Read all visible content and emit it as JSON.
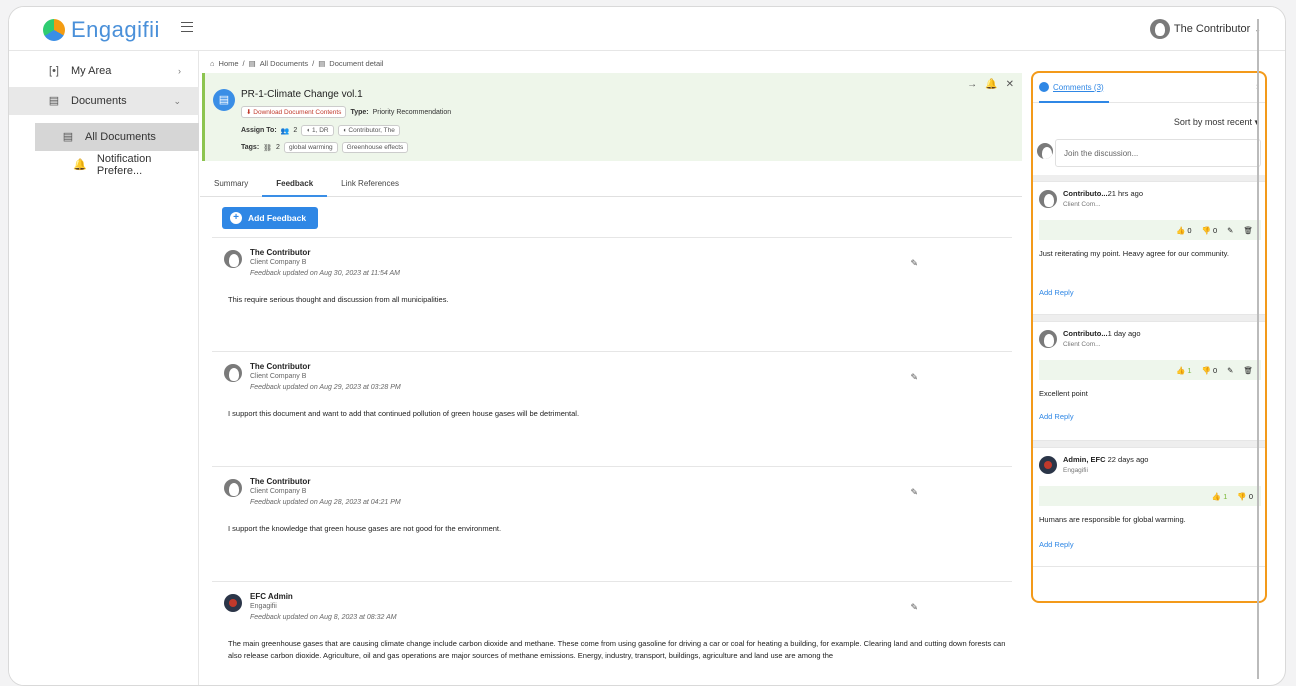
{
  "app": {
    "logo_text": "Engagifii"
  },
  "user": {
    "name": "The Contributor"
  },
  "sidebar": {
    "items": [
      {
        "label": "My Area"
      },
      {
        "label": "Documents"
      },
      {
        "label": "All Documents"
      },
      {
        "label": "Notification Prefere..."
      }
    ]
  },
  "breadcrumb": {
    "home": "Home",
    "all_documents": "All Documents",
    "current": "Document detail"
  },
  "document": {
    "title": "PR-1-Climate Change vol.1",
    "download_label": "Download Document Contents",
    "type_label": "Type:",
    "type_value": "Priority Recommendation",
    "assign_label": "Assign To:",
    "assign_count": "2",
    "assign_user1": "1, DR",
    "assign_user2": "Contributor, The",
    "tags_label": "Tags:",
    "tags_count": "2",
    "tags": [
      "global warming",
      "Greenhouse effects"
    ]
  },
  "tabs": [
    {
      "label": "Summary"
    },
    {
      "label": "Feedback"
    },
    {
      "label": "Link References"
    }
  ],
  "add_feedback_label": "Add Feedback",
  "feedback": [
    {
      "name": "The Contributor",
      "company": "Client Company B",
      "updated": "Feedback updated on Aug 30, 2023 at 11:54 AM",
      "body": "This require serious thought and discussion from all municipalities."
    },
    {
      "name": "The Contributor",
      "company": "Client Company B",
      "updated": "Feedback updated on Aug 29, 2023 at 03:28 PM",
      "body": "I support this document and want to add that continued pollution of green house gases will be detrimental."
    },
    {
      "name": "The Contributor",
      "company": "Client Company B",
      "updated": "Feedback updated on Aug 28, 2023 at 04:21 PM",
      "body": "I support the knowledge that green house gases are not good for the environment."
    },
    {
      "name": "EFC Admin",
      "company": "Engagifii",
      "updated": "Feedback updated on Aug 8, 2023 at 08:32 AM",
      "body": "The main greenhouse gases that are causing climate change include carbon dioxide and methane. These come from using gasoline for driving a car or coal for heating a building, for example. Clearing land and cutting down forests can also release carbon dioxide. Agriculture, oil and gas operations are major sources of methane emissions. Energy, industry, transport, buildings, agriculture and land use are among the"
    }
  ],
  "comments_panel": {
    "tab_label": "Comments (3)",
    "sort_label": "Sort by most recent",
    "join_placeholder": "Join the discussion...",
    "reply_label": "Add Reply",
    "comments": [
      {
        "name": "Contributo...",
        "time": "21 hrs ago",
        "company": "Client Com...",
        "likes": "0",
        "dislikes": "0",
        "text": "Just reiterating my point.  Heavy agree for our community."
      },
      {
        "name": "Contributo...",
        "time": "1 day ago",
        "company": "Client Com...",
        "likes": "1",
        "dislikes": "0",
        "text": "Excellent point"
      },
      {
        "name": "Admin, EFC",
        "time": "22 days ago",
        "company": "Engagifii",
        "likes": "1",
        "dislikes": "0",
        "text": "Humans are responsible for global warming."
      }
    ]
  },
  "colors": {
    "accent": "#2f87e5",
    "highlight_border": "#f39a1a",
    "header_bg": "#eef6ea",
    "like_green": "#7cba3b"
  }
}
